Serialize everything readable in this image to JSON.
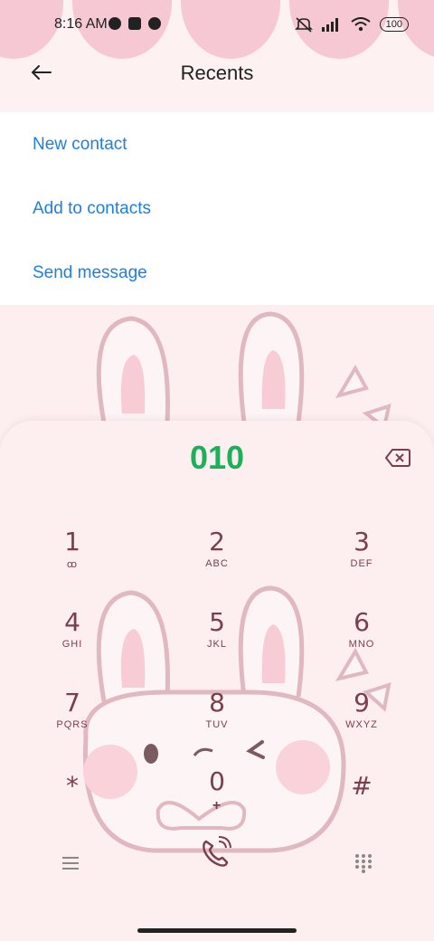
{
  "status": {
    "time": "8:16 AM",
    "battery": "100"
  },
  "header": {
    "title": "Recents"
  },
  "menu": {
    "items": [
      "New contact",
      "Add to contacts",
      "Send message"
    ]
  },
  "dialer": {
    "number": "010",
    "keys": [
      {
        "digit": "1",
        "letters": "ꝏ"
      },
      {
        "digit": "2",
        "letters": "ABC"
      },
      {
        "digit": "3",
        "letters": "DEF"
      },
      {
        "digit": "4",
        "letters": "GHI"
      },
      {
        "digit": "5",
        "letters": "JKL"
      },
      {
        "digit": "6",
        "letters": "MNO"
      },
      {
        "digit": "7",
        "letters": "PQRS"
      },
      {
        "digit": "8",
        "letters": "TUV"
      },
      {
        "digit": "9",
        "letters": "WXYZ"
      },
      {
        "digit": "*",
        "letters": ""
      },
      {
        "digit": "0",
        "letters": "+"
      },
      {
        "digit": "#",
        "letters": ""
      }
    ]
  },
  "colors": {
    "accent_green": "#1cb05a",
    "link_blue": "#1e7fe0",
    "key_text": "#7a3f4b",
    "scallop_pink": "#f6c8d3"
  },
  "icons": [
    "back-arrow-icon",
    "backspace-icon",
    "menu-icon",
    "call-icon",
    "dialpad-icon",
    "wifi-icon",
    "signal-icon",
    "mute-icon"
  ]
}
